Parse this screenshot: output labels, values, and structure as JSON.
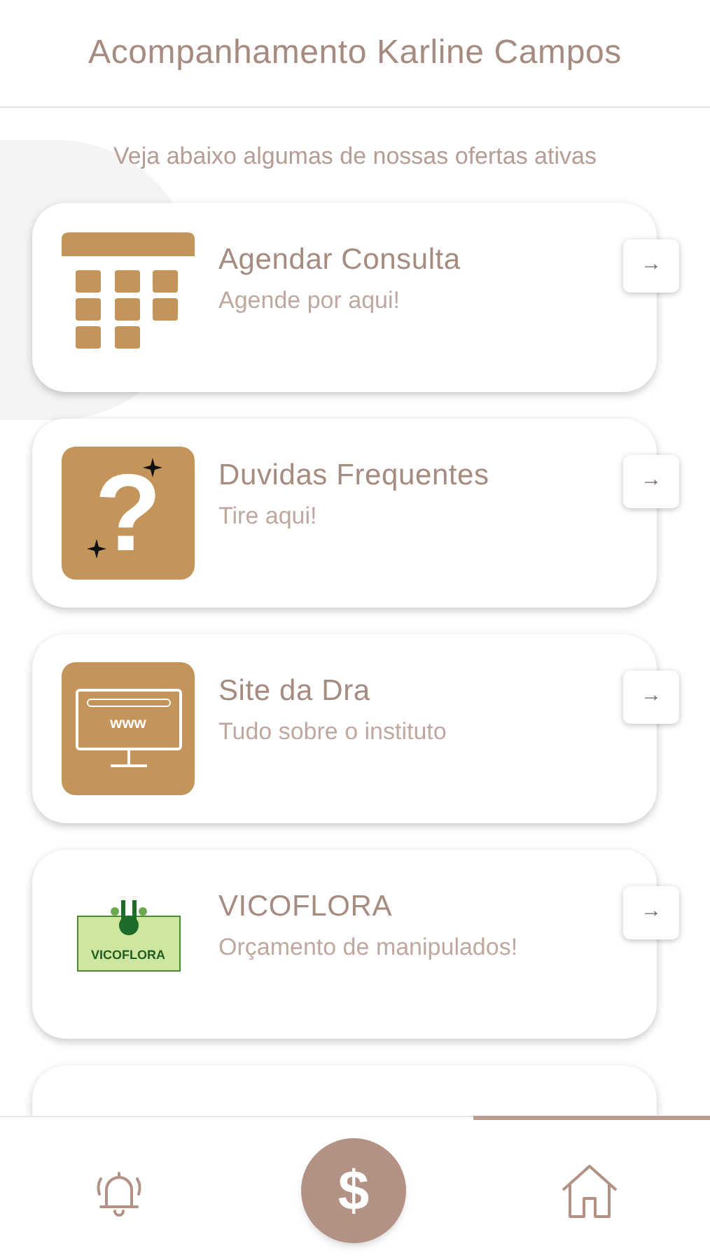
{
  "header": {
    "title": "Acompanhamento Karline Campos"
  },
  "subtitle": "Veja abaixo algumas de nossas ofertas ativas",
  "offers": [
    {
      "kind": "calendar",
      "title": "Agendar Consulta",
      "subtitle": "Agende por aqui!",
      "arrow": "→"
    },
    {
      "kind": "question",
      "icon_text": "?",
      "title": "Duvidas Frequentes",
      "subtitle": "Tire aqui!",
      "arrow": "→"
    },
    {
      "kind": "web",
      "icon_text": "www",
      "title": "Site da Dra",
      "subtitle": "Tudo sobre o instituto",
      "arrow": "→"
    },
    {
      "kind": "logo",
      "icon_text": "VICOFLORA",
      "title": "VICOFLORA",
      "subtitle": "Orçamento de manipulados!",
      "arrow": "→"
    },
    {
      "kind": "hidden"
    }
  ],
  "bottom_nav": {
    "center_label": "$"
  }
}
